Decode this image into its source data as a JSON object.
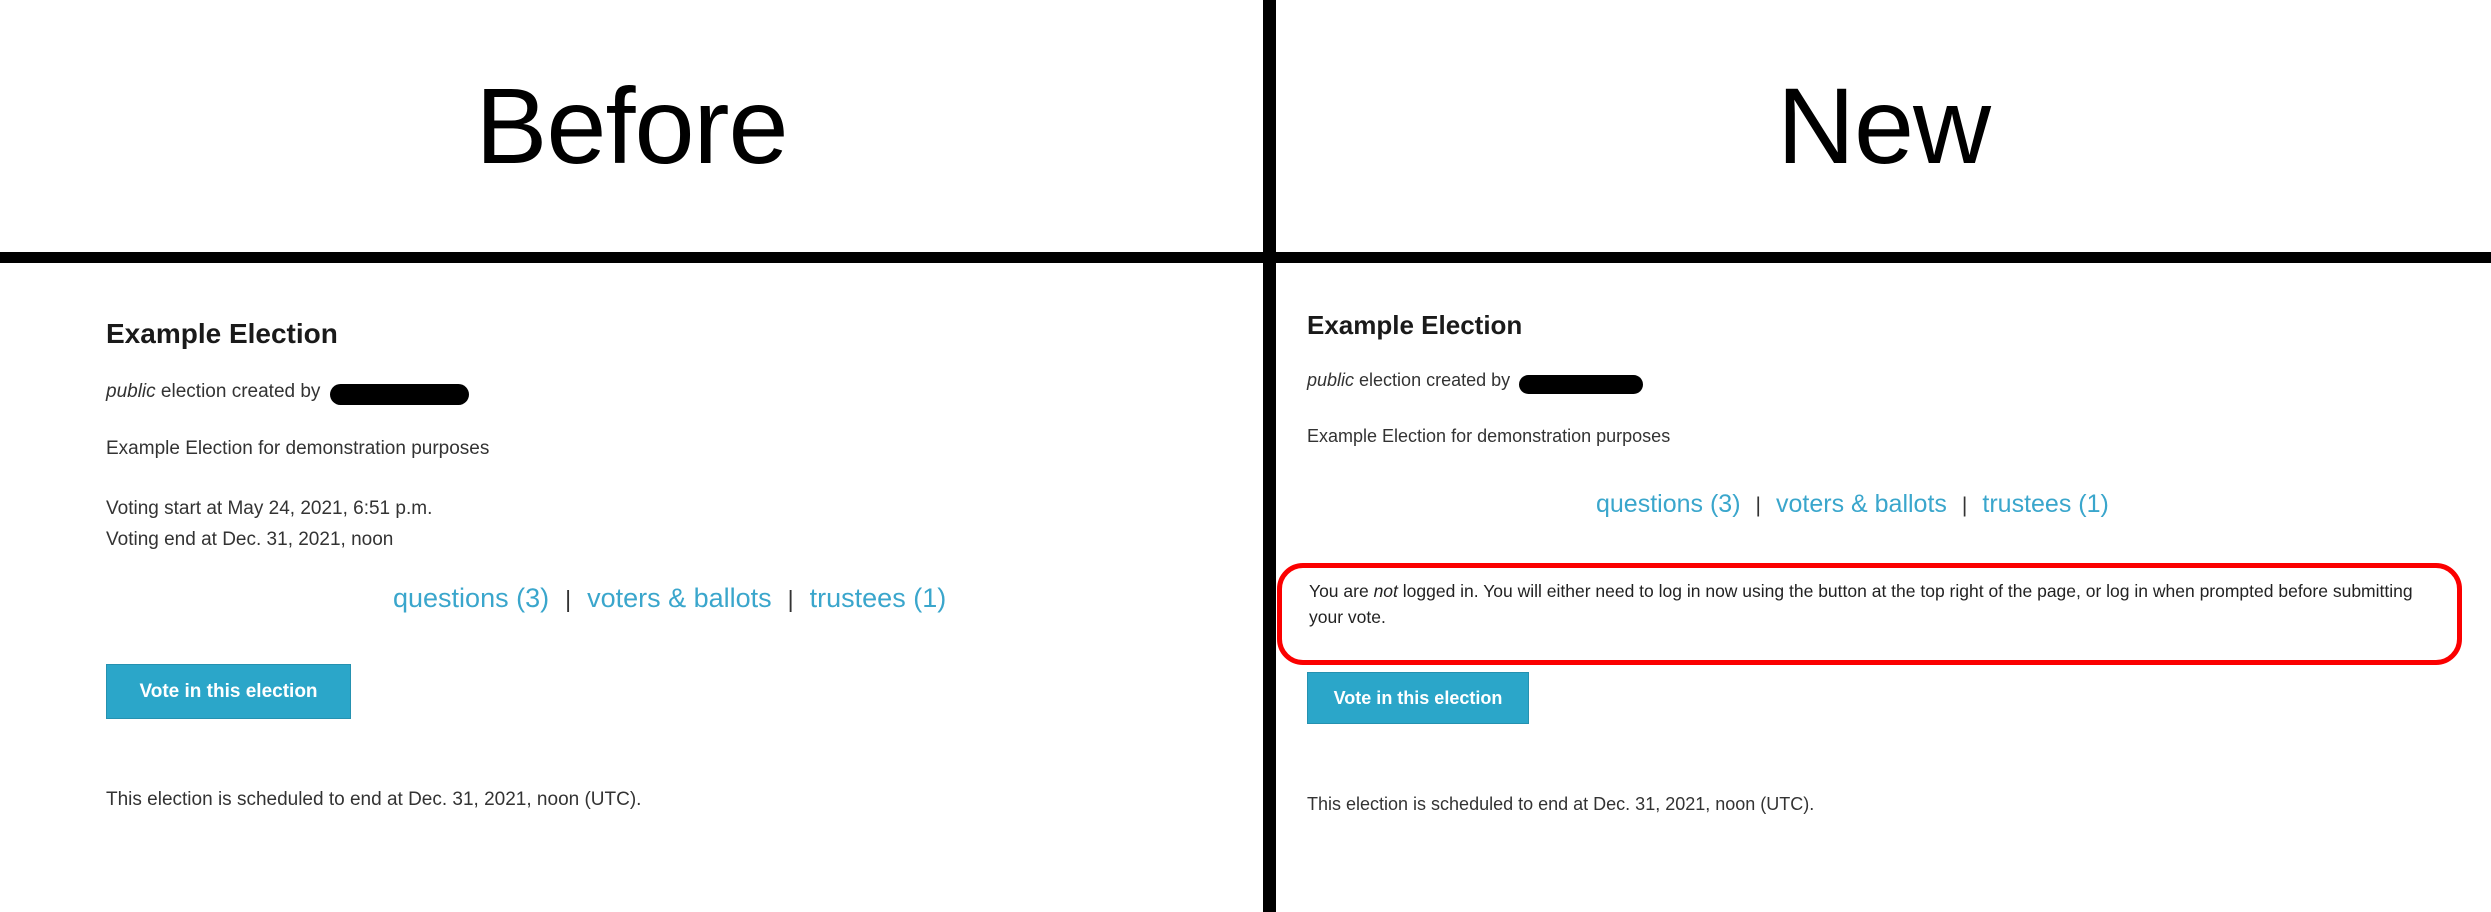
{
  "panels": {
    "left": {
      "header": "Before",
      "election": {
        "title": "Example Election",
        "created_prefix_visibility": "public",
        "created_by_text": " election created by ",
        "redacted_creator": "",
        "description": "Example Election for demonstration purposes",
        "voting_start": "Voting start at May 24, 2021, 6:51 p.m.",
        "voting_end": "Voting end at Dec. 31, 2021, noon",
        "links": [
          {
            "label": "questions (3)"
          },
          {
            "label": "voters & ballots"
          },
          {
            "label": "trustees (1)"
          }
        ],
        "link_separator": "|",
        "vote_button": "Vote in this election",
        "footer_note": "This election is scheduled to end at Dec. 31, 2021, noon (UTC)."
      }
    },
    "right": {
      "header": "New",
      "election": {
        "title": "Example Election",
        "created_prefix_visibility": "public",
        "created_by_text": " election created by ",
        "redacted_creator": "",
        "description": "Example Election for demonstration purposes",
        "links": [
          {
            "label": "questions (3)"
          },
          {
            "label": "voters & ballots"
          },
          {
            "label": "trustees (1)"
          }
        ],
        "link_separator": "|",
        "warning": {
          "lead": "You are ",
          "emphasis": "not",
          "rest": " logged in. You will either need to log in now using the button at the top right of the page, or log in when prompted before submitting your vote."
        },
        "vote_button": "Vote in this election",
        "footer_note": "This election is scheduled to end at Dec. 31, 2021, noon (UTC)."
      }
    }
  },
  "colors": {
    "link": "#3aa6cc",
    "button_bg": "#2ba6c9",
    "warning_border": "#fb0000",
    "divider": "#000000",
    "text": "#333333",
    "heading": "#1a1a1a"
  }
}
